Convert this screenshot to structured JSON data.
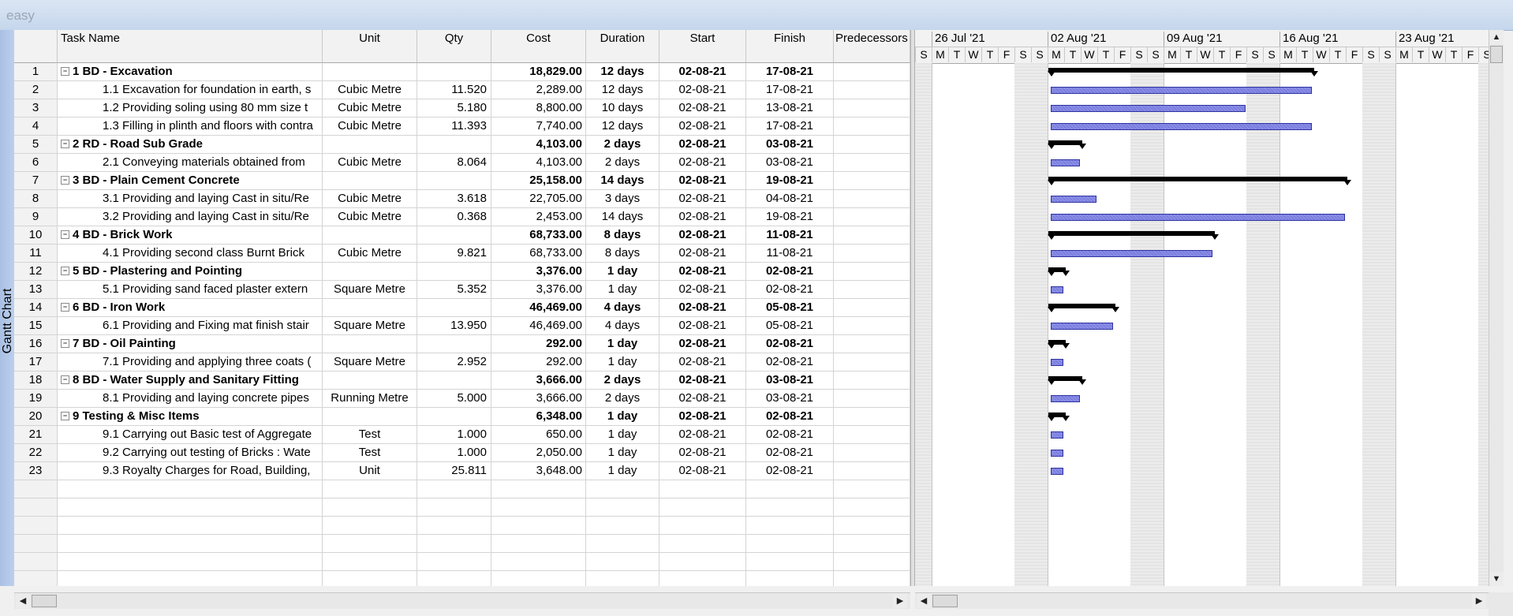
{
  "window": {
    "title": "easy"
  },
  "view": {
    "label": "Gantt Chart"
  },
  "columns": {
    "name": "Task Name",
    "unit": "Unit",
    "qty": "Qty",
    "cost": "Cost",
    "duration": "Duration",
    "start": "Start",
    "finish": "Finish",
    "pred": "Predecessors"
  },
  "timescale": {
    "weeks": [
      "26 Jul '21",
      "02 Aug '21",
      "09 Aug '21",
      "16 Aug '21",
      "23 Aug '21"
    ],
    "days": [
      "S",
      "M",
      "T",
      "W",
      "T",
      "F",
      "S",
      "S",
      "M",
      "T",
      "W",
      "T",
      "F",
      "S",
      "S",
      "M",
      "T",
      "W",
      "T",
      "F",
      "S",
      "S",
      "M",
      "T",
      "W",
      "T",
      "F",
      "S",
      "S",
      "M",
      "T",
      "W",
      "T",
      "F",
      "S"
    ]
  },
  "colors": {
    "task_bar": "#7a7ee0",
    "summary_bar": "#000000"
  },
  "tasks": [
    {
      "id": "1",
      "name": "1 BD - Excavation",
      "unit": "",
      "qty": "",
      "cost": "18,829.00",
      "duration": "12 days",
      "start": "02-08-21",
      "finish": "17-08-21",
      "summary": true,
      "days": 12
    },
    {
      "id": "2",
      "name": "1.1 Excavation for foundation in earth, s",
      "unit": "Cubic Metre",
      "qty": "11.520",
      "cost": "2,289.00",
      "duration": "12 days",
      "start": "02-08-21",
      "finish": "17-08-21",
      "summary": false,
      "days": 12
    },
    {
      "id": "3",
      "name": "1.2 Providing soling using 80 mm size t",
      "unit": "Cubic Metre",
      "qty": "5.180",
      "cost": "8,800.00",
      "duration": "10 days",
      "start": "02-08-21",
      "finish": "13-08-21",
      "summary": false,
      "days": 10
    },
    {
      "id": "4",
      "name": "1.3 Filling in plinth and floors with contra",
      "unit": "Cubic Metre",
      "qty": "11.393",
      "cost": "7,740.00",
      "duration": "12 days",
      "start": "02-08-21",
      "finish": "17-08-21",
      "summary": false,
      "days": 12
    },
    {
      "id": "5",
      "name": "2 RD - Road Sub Grade",
      "unit": "",
      "qty": "",
      "cost": "4,103.00",
      "duration": "2 days",
      "start": "02-08-21",
      "finish": "03-08-21",
      "summary": true,
      "days": 2
    },
    {
      "id": "6",
      "name": "2.1 Conveying materials obtained from",
      "unit": "Cubic Metre",
      "qty": "8.064",
      "cost": "4,103.00",
      "duration": "2 days",
      "start": "02-08-21",
      "finish": "03-08-21",
      "summary": false,
      "days": 2
    },
    {
      "id": "7",
      "name": "3 BD - Plain Cement Concrete",
      "unit": "",
      "qty": "",
      "cost": "25,158.00",
      "duration": "14 days",
      "start": "02-08-21",
      "finish": "19-08-21",
      "summary": true,
      "days": 14
    },
    {
      "id": "8",
      "name": "3.1 Providing and laying Cast in situ/Re",
      "unit": "Cubic Metre",
      "qty": "3.618",
      "cost": "22,705.00",
      "duration": "3 days",
      "start": "02-08-21",
      "finish": "04-08-21",
      "summary": false,
      "days": 3
    },
    {
      "id": "9",
      "name": "3.2 Providing and laying Cast in situ/Re",
      "unit": "Cubic Metre",
      "qty": "0.368",
      "cost": "2,453.00",
      "duration": "14 days",
      "start": "02-08-21",
      "finish": "19-08-21",
      "summary": false,
      "days": 14
    },
    {
      "id": "10",
      "name": "4 BD - Brick Work",
      "unit": "",
      "qty": "",
      "cost": "68,733.00",
      "duration": "8 days",
      "start": "02-08-21",
      "finish": "11-08-21",
      "summary": true,
      "days": 8
    },
    {
      "id": "11",
      "name": "4.1 Providing second class Burnt Brick",
      "unit": "Cubic Metre",
      "qty": "9.821",
      "cost": "68,733.00",
      "duration": "8 days",
      "start": "02-08-21",
      "finish": "11-08-21",
      "summary": false,
      "days": 8
    },
    {
      "id": "12",
      "name": "5 BD - Plastering and Pointing",
      "unit": "",
      "qty": "",
      "cost": "3,376.00",
      "duration": "1 day",
      "start": "02-08-21",
      "finish": "02-08-21",
      "summary": true,
      "days": 1
    },
    {
      "id": "13",
      "name": "5.1 Providing sand faced plaster extern",
      "unit": "Square Metre",
      "qty": "5.352",
      "cost": "3,376.00",
      "duration": "1 day",
      "start": "02-08-21",
      "finish": "02-08-21",
      "summary": false,
      "days": 1
    },
    {
      "id": "14",
      "name": "6 BD - Iron Work",
      "unit": "",
      "qty": "",
      "cost": "46,469.00",
      "duration": "4 days",
      "start": "02-08-21",
      "finish": "05-08-21",
      "summary": true,
      "days": 4
    },
    {
      "id": "15",
      "name": "6.1 Providing and Fixing mat finish stair",
      "unit": "Square Metre",
      "qty": "13.950",
      "cost": "46,469.00",
      "duration": "4 days",
      "start": "02-08-21",
      "finish": "05-08-21",
      "summary": false,
      "days": 4
    },
    {
      "id": "16",
      "name": "7 BD - Oil Painting",
      "unit": "",
      "qty": "",
      "cost": "292.00",
      "duration": "1 day",
      "start": "02-08-21",
      "finish": "02-08-21",
      "summary": true,
      "days": 1
    },
    {
      "id": "17",
      "name": "7.1 Providing and applying three coats (",
      "unit": "Square Metre",
      "qty": "2.952",
      "cost": "292.00",
      "duration": "1 day",
      "start": "02-08-21",
      "finish": "02-08-21",
      "summary": false,
      "days": 1
    },
    {
      "id": "18",
      "name": "8 BD - Water Supply and Sanitary Fitting",
      "unit": "",
      "qty": "",
      "cost": "3,666.00",
      "duration": "2 days",
      "start": "02-08-21",
      "finish": "03-08-21",
      "summary": true,
      "days": 2
    },
    {
      "id": "19",
      "name": "8.1 Providing and laying concrete pipes",
      "unit": "Running Metre",
      "qty": "5.000",
      "cost": "3,666.00",
      "duration": "2 days",
      "start": "02-08-21",
      "finish": "03-08-21",
      "summary": false,
      "days": 2
    },
    {
      "id": "20",
      "name": "9 Testing & Misc Items",
      "unit": "",
      "qty": "",
      "cost": "6,348.00",
      "duration": "1 day",
      "start": "02-08-21",
      "finish": "02-08-21",
      "summary": true,
      "days": 1
    },
    {
      "id": "21",
      "name": "9.1 Carrying out Basic test of Aggregate",
      "unit": "Test",
      "qty": "1.000",
      "cost": "650.00",
      "duration": "1 day",
      "start": "02-08-21",
      "finish": "02-08-21",
      "summary": false,
      "days": 1
    },
    {
      "id": "22",
      "name": "9.2 Carrying out testing of Bricks : Wate",
      "unit": "Test",
      "qty": "1.000",
      "cost": "2,050.00",
      "duration": "1 day",
      "start": "02-08-21",
      "finish": "02-08-21",
      "summary": false,
      "days": 1
    },
    {
      "id": "23",
      "name": "9.3 Royalty Charges for Road, Building,",
      "unit": "Unit",
      "qty": "25.811",
      "cost": "3,648.00",
      "duration": "1 day",
      "start": "02-08-21",
      "finish": "02-08-21",
      "summary": false,
      "days": 1
    }
  ],
  "empty_rows": 6
}
